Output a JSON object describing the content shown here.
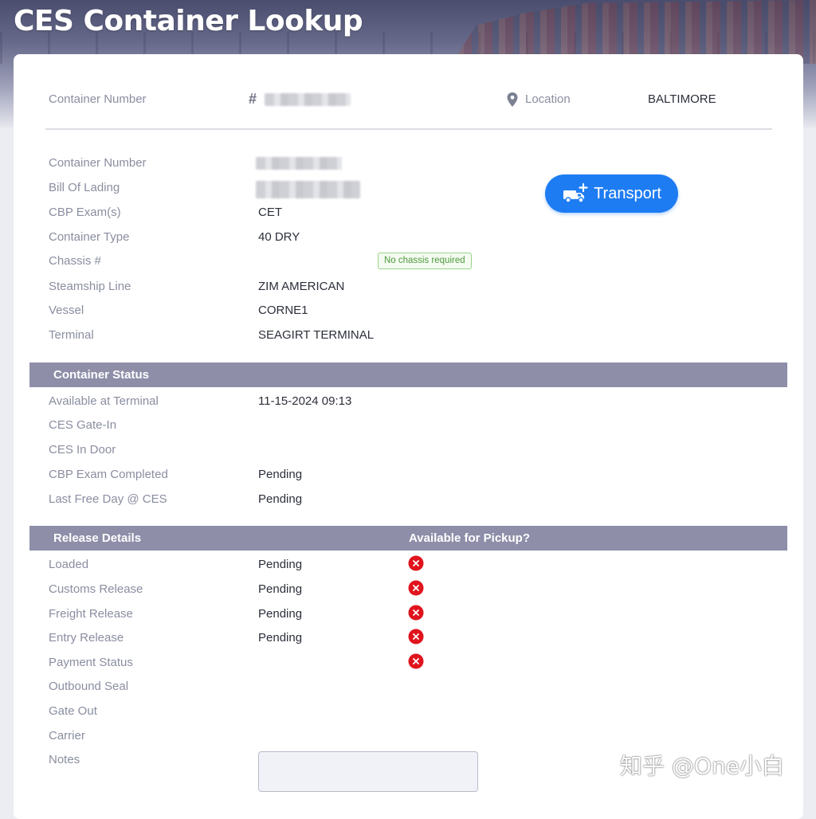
{
  "header": {
    "title": "CES Container Lookup"
  },
  "top": {
    "container_number_label": "Container Number",
    "location_label": "Location",
    "location_value": "BALTIMORE"
  },
  "details": [
    {
      "label": "Container Number",
      "value": ""
    },
    {
      "label": "Bill Of Lading",
      "value": ""
    },
    {
      "label": "CBP Exam(s)",
      "value": "CET"
    },
    {
      "label": "Container Type",
      "value": "40 DRY"
    },
    {
      "label": "Chassis #",
      "value": ""
    },
    {
      "label": "Steamship Line",
      "value": "ZIM AMERICAN"
    },
    {
      "label": "Vessel",
      "value": "CORNE1"
    },
    {
      "label": "Terminal",
      "value": "SEAGIRT TERMINAL"
    }
  ],
  "chassis_badge": "No chassis required",
  "transport_button": {
    "label": "Transport",
    "icon": "truck-plus-icon",
    "color": "#1e7cf2"
  },
  "container_status": {
    "title": "Container Status",
    "rows": [
      {
        "label": "Available at Terminal",
        "value": "11-15-2024 09:13"
      },
      {
        "label": "CES Gate-In",
        "value": ""
      },
      {
        "label": "CES In Door",
        "value": ""
      },
      {
        "label": "CBP Exam Completed",
        "value": "Pending"
      },
      {
        "label": "Last Free Day @ CES",
        "value": "Pending"
      }
    ]
  },
  "release_details": {
    "title": "Release Details",
    "pickup_header": "Available for Pickup?",
    "rows": [
      {
        "label": "Loaded",
        "value": "Pending",
        "status_icon": "x-circle-icon"
      },
      {
        "label": "Customs Release",
        "value": "Pending",
        "status_icon": "x-circle-icon"
      },
      {
        "label": "Freight Release",
        "value": "Pending",
        "status_icon": "x-circle-icon"
      },
      {
        "label": "Entry Release",
        "value": "Pending",
        "status_icon": "x-circle-icon"
      },
      {
        "label": "Payment Status",
        "value": "",
        "status_icon": "x-circle-icon"
      },
      {
        "label": "Outbound Seal",
        "value": ""
      },
      {
        "label": "Gate Out",
        "value": ""
      },
      {
        "label": "Carrier",
        "value": ""
      },
      {
        "label": "Notes",
        "value": ""
      }
    ]
  },
  "watermark": "知乎 @One小白",
  "colors": {
    "section_bar": "#8e8ea9",
    "error": "#e0141e",
    "badge_green": "#4e9a3a"
  }
}
